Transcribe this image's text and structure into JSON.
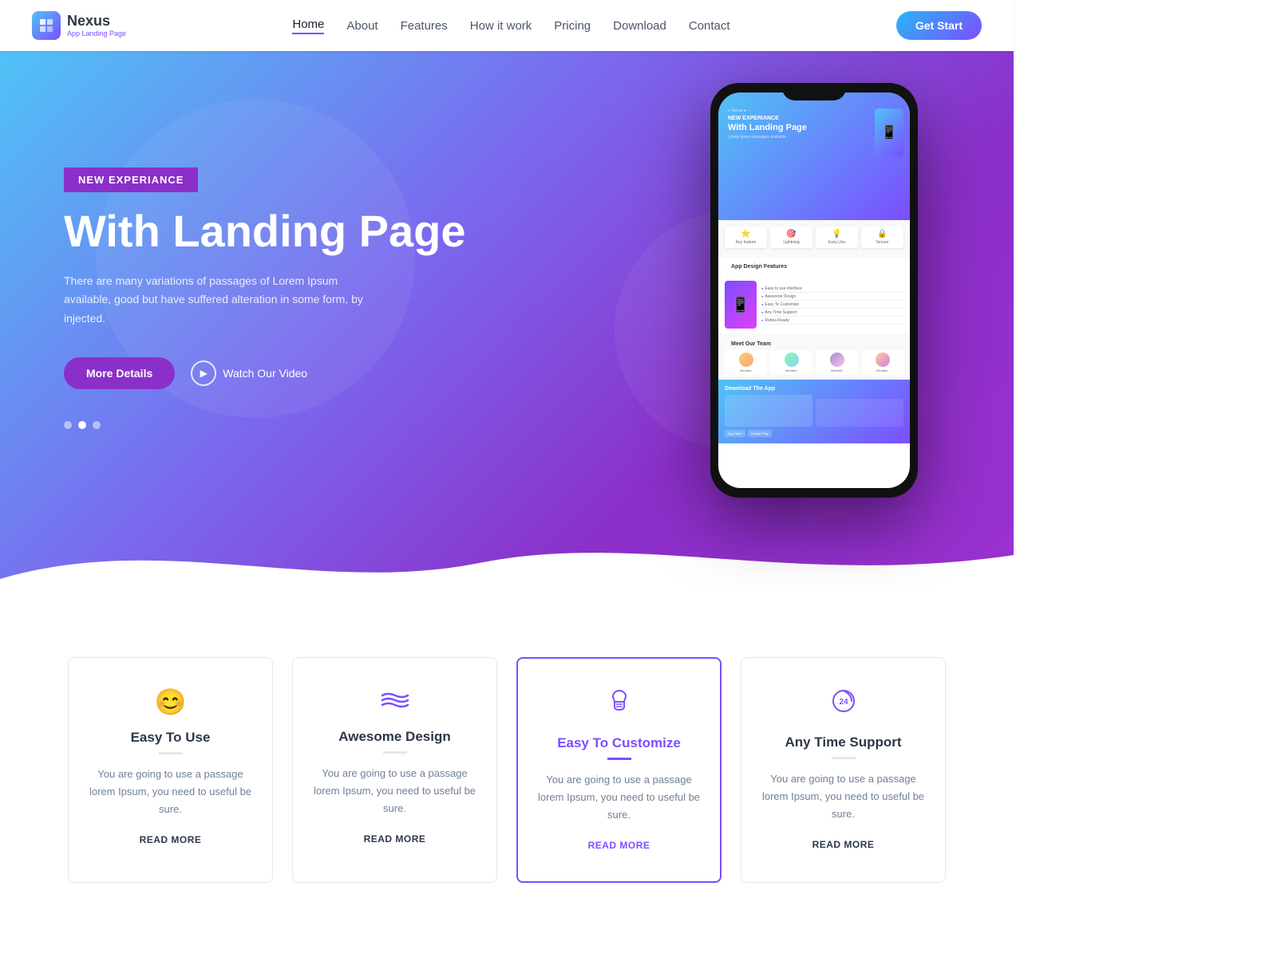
{
  "logo": {
    "name": "Nexus",
    "subtitle": "App Landing Page",
    "icon": "N"
  },
  "nav": {
    "links": [
      {
        "label": "Home",
        "active": true
      },
      {
        "label": "About",
        "active": false
      },
      {
        "label": "Features",
        "active": false
      },
      {
        "label": "How it work",
        "active": false
      },
      {
        "label": "Pricing",
        "active": false
      },
      {
        "label": "Download",
        "active": false
      },
      {
        "label": "Contact",
        "active": false
      }
    ],
    "cta": "Get Start"
  },
  "hero": {
    "badge": "NEW EXPERIANCE",
    "title": "With Landing Page",
    "description": "There are many variations of passages of Lorem Ipsum available, good but have suffered alteration in some form, by injected.",
    "btn_more": "More Details",
    "btn_video": "Watch Our Video",
    "dots": [
      {
        "active": false
      },
      {
        "active": true
      },
      {
        "active": false
      }
    ]
  },
  "features": [
    {
      "icon": "😊",
      "title": "Easy To Use",
      "description": "You are going to use a passage lorem Ipsum, you need to useful be sure.",
      "link": "READ MORE",
      "active": false
    },
    {
      "icon": "〰",
      "title": "Awesome Design",
      "description": "You are going to use a passage lorem Ipsum, you need to useful be sure.",
      "link": "READ MORE",
      "active": false
    },
    {
      "icon": "🤲",
      "title": "Easy To Customize",
      "description": "You are going to use a passage lorem Ipsum, you need to useful be sure.",
      "link": "READ MORE",
      "active": true
    },
    {
      "icon": "🕐",
      "title": "Any Time Support",
      "description": "You are going to use a passage lorem Ipsum, you need to useful be sure.",
      "link": "READ MORE",
      "active": false
    }
  ],
  "colors": {
    "primary": "#7c4dff",
    "secondary": "#4fc3f7",
    "accent": "#8b2fc9",
    "text_dark": "#2d3748",
    "text_muted": "#718096"
  }
}
